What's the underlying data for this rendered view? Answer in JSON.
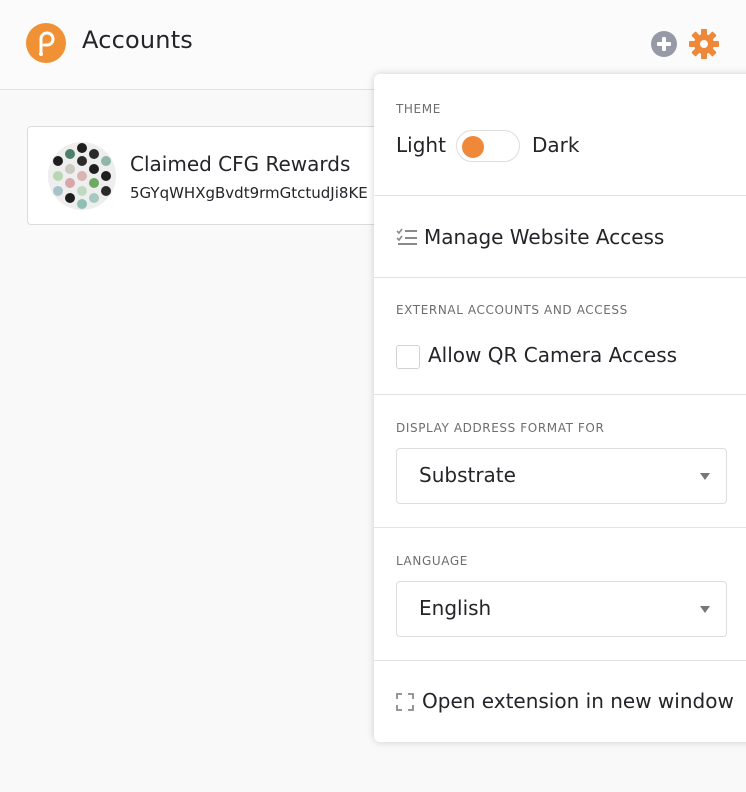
{
  "header": {
    "title": "Accounts",
    "logo_icon": "polkadot-logo-icon",
    "add_icon": "plus-circle-icon",
    "settings_icon": "gear-icon"
  },
  "account": {
    "name": "Claimed CFG Rewards",
    "address": "5GYqWHXgBvdt9rmGtctudJi8KE"
  },
  "settings": {
    "theme": {
      "label": "Theme",
      "light": "Light",
      "dark": "Dark",
      "selected": "Light"
    },
    "manage_access": "Manage Website Access",
    "external": {
      "label": "External accounts and access",
      "qr_camera": "Allow QR Camera Access",
      "qr_checked": false
    },
    "address_format": {
      "label": "Display address format for",
      "value": "Substrate"
    },
    "language": {
      "label": "Language",
      "value": "English"
    },
    "open_window": "Open extension in new window"
  },
  "colors": {
    "accent": "#f0883a",
    "text": "#242529",
    "muted": "#6d6d6d"
  }
}
